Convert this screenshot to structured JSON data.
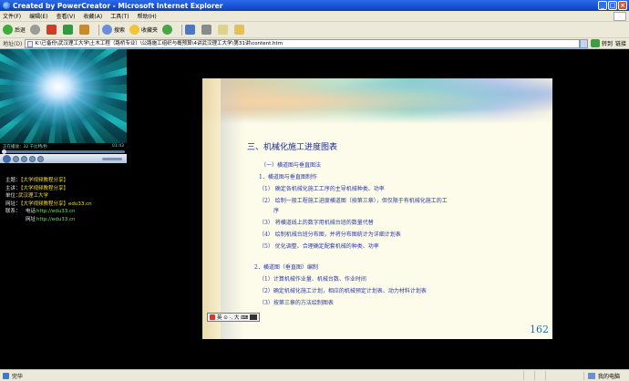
{
  "window": {
    "title": "Created by PowerCreator - Microsoft Internet Explorer",
    "min_label": "_",
    "max_label": "□",
    "close_label": "×"
  },
  "menu": [
    "文件(F)",
    "编辑(E)",
    "查看(V)",
    "收藏(A)",
    "工具(T)",
    "帮助(H)"
  ],
  "toolbar": {
    "back_label": "后退",
    "search_label": "搜索",
    "favorites_label": "收藏夹"
  },
  "address": {
    "label": "地址(D)",
    "value": "K:\\已备份\\武汉理工大学\\土木工程（路桥专业）\\公路施工组织与概预算\\4讲武汉理工大学\\第31讲\\content.htm",
    "go_label": "转到",
    "links_label": "链接"
  },
  "player": {
    "status_left": "正在播放：32 千比特/秒",
    "status_time": "01:43"
  },
  "course_info": {
    "rows": [
      {
        "key": "主题：",
        "value": "【大学视频教程分享】",
        "type": "text"
      },
      {
        "key": "主讲：",
        "value": "【大学视频教程分享】",
        "type": "text"
      },
      {
        "key": "单位：",
        "value": "武汉理工大学",
        "type": "text"
      },
      {
        "key": "网址：",
        "value": "【大学视频教程分享】edu33.cn",
        "type": "url"
      }
    ],
    "contact_key": "联系：",
    "contact_rows": [
      {
        "key": "电话",
        "value": "http://edu33.cn"
      },
      {
        "key": "网址",
        "value": "http://edu33.cn"
      }
    ]
  },
  "slide": {
    "title": "三、机械化施工进度图表",
    "lines": [
      "（一）横道图与垂直图法",
      "1．横道图与垂直图制作",
      "（1）  确定各机械化施工工序的主导机械种类、功率",
      "（2）  绘制一般工程施工进度横道图（按第三章），但仅限于有机械化施工的工",
      "序",
      "（3）  将横道线上的数字用机械台班的数量代替",
      "（4）  绘制机械台班分布图，并将分布图统计为详细计划表",
      "（5）  优化调整、合理确定配套机械的种类、功率",
      "2．横道图（垂直图）编制",
      "（1）计算机械作业量、机械台数、作业时间",
      "（2）确定机械化施工计划，相应的机械预定计划表、动力材料计划表",
      "（3）按第三章的方法绘制图表"
    ],
    "page_number": "162",
    "ime_text": "英 ⊙ ·, 大 ⌨"
  },
  "status": {
    "left": "完毕",
    "zone": "我的电脑"
  }
}
